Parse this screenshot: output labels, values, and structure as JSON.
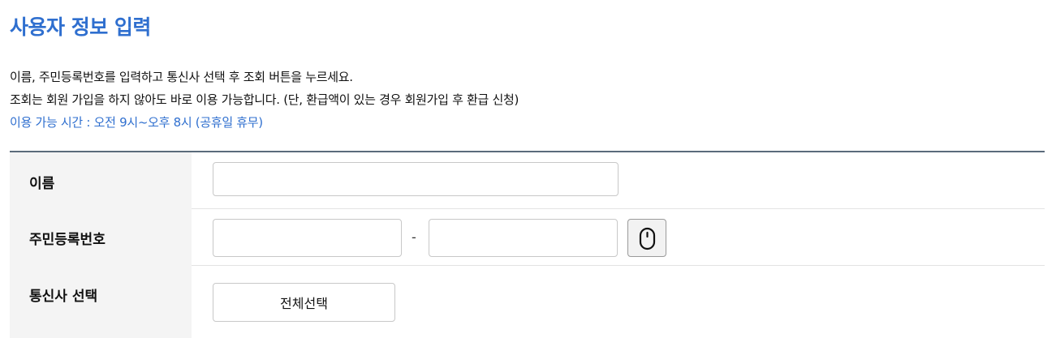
{
  "header": {
    "title": "사용자 정보 입력"
  },
  "description": {
    "line1": "이름, 주민등록번호를 입력하고 통신사 선택 후 조회 버튼을 누르세요.",
    "line2": "조회는 회원 가입을 하지 않아도 바로 이용 가능합니다. (단, 환급액이 있는 경우 회원가입 후 환급 신청)",
    "hours": "이용 가능 시간 : 오전 9시~오후 8시 (공휴일 휴무)"
  },
  "form": {
    "name": {
      "label": "이름",
      "value": "",
      "placeholder": ""
    },
    "resident_number": {
      "label": "주민등록번호",
      "front_value": "",
      "back_value": "",
      "separator": "-",
      "toggle_icon": "mouse-icon"
    },
    "carrier": {
      "label": "통신사 선택",
      "select_all_label": "전체선택"
    }
  },
  "colors": {
    "accent": "#2f6fcf",
    "label_bg": "#f4f4f4",
    "table_top_border": "#5b6b7b"
  }
}
